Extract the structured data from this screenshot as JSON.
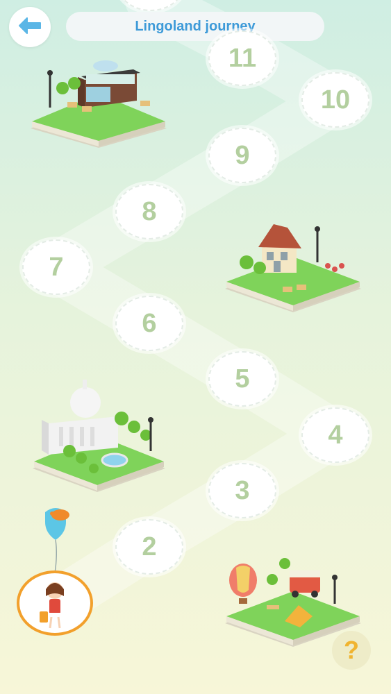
{
  "header": {
    "title": "Lingoland journey",
    "back_icon": "arrow-left-icon"
  },
  "levels": [
    {
      "number": "11"
    },
    {
      "number": "10"
    },
    {
      "number": "9"
    },
    {
      "number": "8"
    },
    {
      "number": "7"
    },
    {
      "number": "6"
    },
    {
      "number": "5"
    },
    {
      "number": "4"
    },
    {
      "number": "3"
    },
    {
      "number": "2"
    }
  ],
  "help": {
    "label": "?"
  },
  "colors": {
    "accent": "#3d9ad8",
    "level_text": "#b3cf9f",
    "avatar_ring": "#f2a02c",
    "help": "#f0b430"
  }
}
